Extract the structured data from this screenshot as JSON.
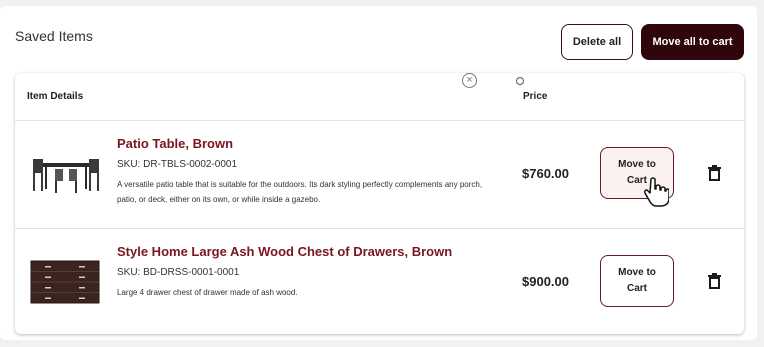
{
  "page": {
    "title": "Saved Items",
    "delete_all_label": "Delete all",
    "move_all_label": "Move all to cart"
  },
  "table": {
    "headers": {
      "item_details": "Item Details",
      "price": "Price"
    }
  },
  "items": [
    {
      "name": "Patio Table, Brown",
      "sku": "SKU: DR-TBLS-0002-0001",
      "description": "A versatile patio table that is suitable for the outdoors. Its dark styling perfectly complements any porch, patio, or deck, either on its own, or while inside a gazebo.",
      "price": "$760.00",
      "move_label": "Move to Cart",
      "image_icon": "patio-table-image"
    },
    {
      "name": "Style Home Large Ash Wood Chest of Drawers, Brown",
      "sku": "SKU: BD-DRSS-0001-0001",
      "description": "Large 4 drawer chest of drawer made of ash wood.",
      "price": "$900.00",
      "move_label": "Move to Cart",
      "image_icon": "chest-of-drawers-image"
    }
  ],
  "colors": {
    "brand_dark": "#2e060b",
    "product_name": "#7a1620",
    "button_border": "#6b1820"
  }
}
